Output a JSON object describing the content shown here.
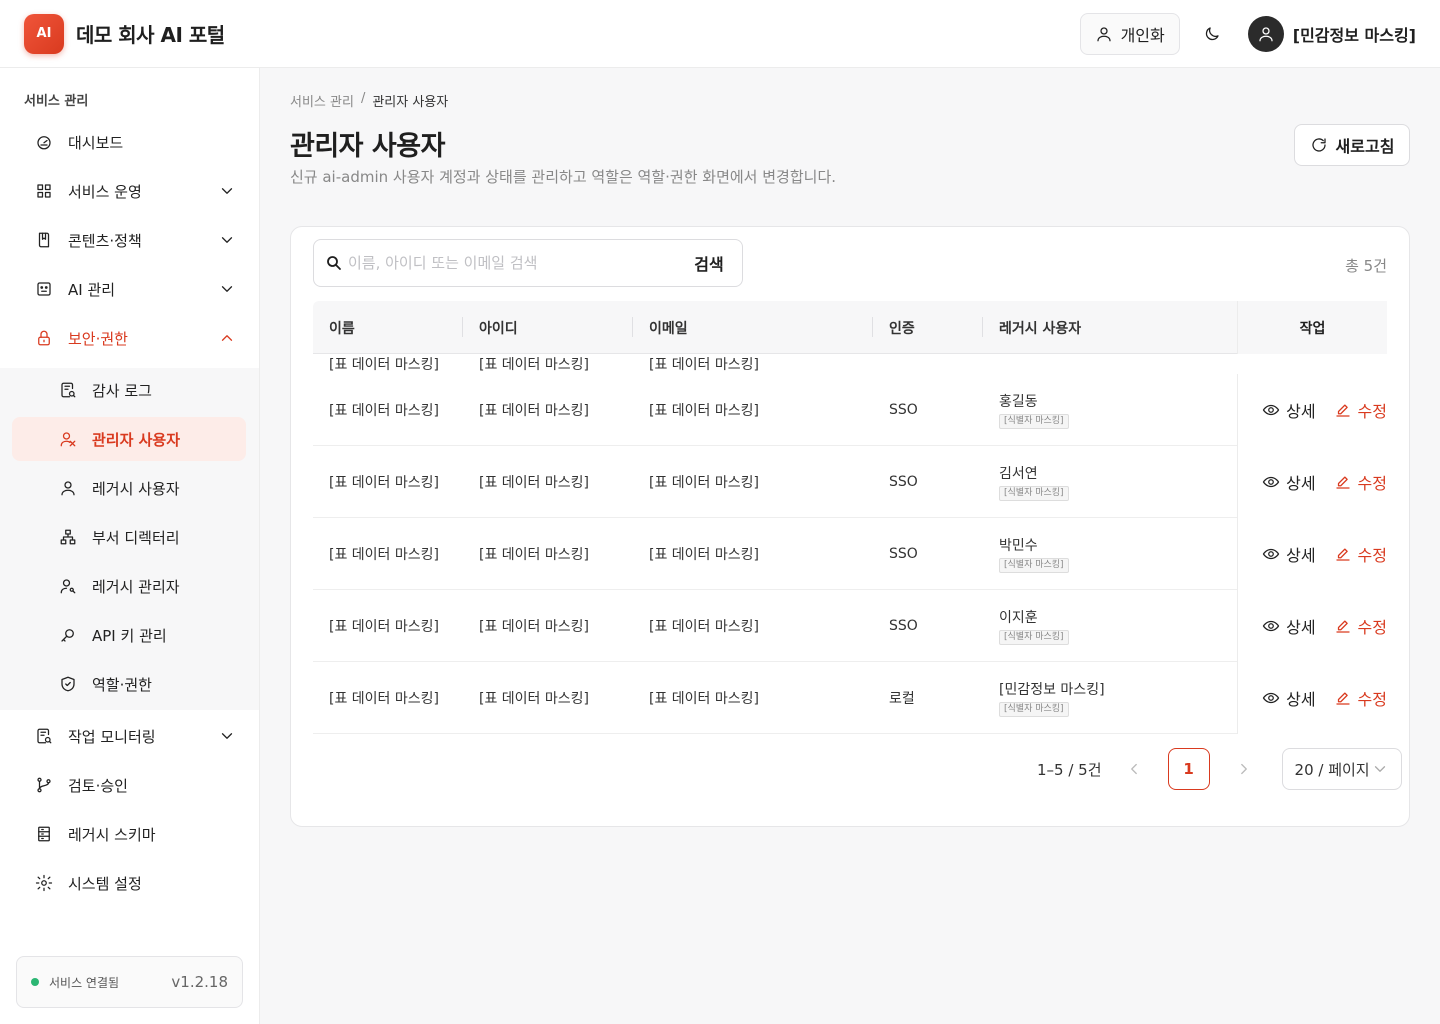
{
  "header": {
    "logo_text": "AI",
    "brand": "데모 회사 AI 포털",
    "personal_label": "개인화",
    "user_name": "[민감정보 마스킹]"
  },
  "sidebar": {
    "section_title": "서비스 관리",
    "items": [
      {
        "label": "대시보드",
        "icon": "dashboard-icon"
      },
      {
        "label": "서비스 운영",
        "icon": "grid-icon"
      },
      {
        "label": "콘텐츠·정책",
        "icon": "book-icon"
      },
      {
        "label": "AI 관리",
        "icon": "robot-icon"
      },
      {
        "label": "보안·권한",
        "icon": "lock-icon"
      },
      {
        "label": "감사 로그",
        "icon": "audit-icon"
      },
      {
        "label": "관리자 사용자",
        "icon": "users-icon"
      },
      {
        "label": "레거시 사용자",
        "icon": "user-icon"
      },
      {
        "label": "부서 디렉터리",
        "icon": "org-icon"
      },
      {
        "label": "레거시 관리자",
        "icon": "user-key-icon"
      },
      {
        "label": "API 키 관리",
        "icon": "key-icon"
      },
      {
        "label": "역할·권한",
        "icon": "shield-icon"
      },
      {
        "label": "작업 모니터링",
        "icon": "monitor-icon"
      },
      {
        "label": "검토·승인",
        "icon": "branch-icon"
      },
      {
        "label": "레거시 스키마",
        "icon": "schema-icon"
      },
      {
        "label": "시스템 설정",
        "icon": "gear-icon"
      }
    ],
    "status_text": "서비스 연결됨",
    "version": "v1.2.18",
    "status_color": "#2bb673"
  },
  "breadcrumb": {
    "parent": "서비스 관리",
    "separator": "/",
    "current": "관리자 사용자"
  },
  "page": {
    "title": "관리자 사용자",
    "description": "신규 ai-admin 사용자 계정과 상태를 관리하고 역할은 역할·권한 화면에서 변경합니다.",
    "refresh_label": "새로고침"
  },
  "search": {
    "placeholder": "이름, 아이디 또는 이메일 검색",
    "button": "검색"
  },
  "total": "총 5건",
  "table": {
    "headers": {
      "name": "이름",
      "id": "아이디",
      "email": "이메일",
      "auth": "인증",
      "legacy": "레거시 사용자",
      "action": "작업"
    },
    "partial_row": {
      "name": "[표 데이터 마스킹]",
      "id": "[표 데이터 마스킹]",
      "email": "[표 데이터 마스킹]"
    },
    "rows": [
      {
        "name": "[표 데이터 마스킹]",
        "id": "[표 데이터 마스킹]",
        "email": "[표 데이터 마스킹]",
        "auth": "SSO",
        "legacy": "홍길동",
        "tag": "[식별자 마스킹]"
      },
      {
        "name": "[표 데이터 마스킹]",
        "id": "[표 데이터 마스킹]",
        "email": "[표 데이터 마스킹]",
        "auth": "SSO",
        "legacy": "김서연",
        "tag": "[식별자 마스킹]"
      },
      {
        "name": "[표 데이터 마스킹]",
        "id": "[표 데이터 마스킹]",
        "email": "[표 데이터 마스킹]",
        "auth": "SSO",
        "legacy": "박민수",
        "tag": "[식별자 마스킹]"
      },
      {
        "name": "[표 데이터 마스킹]",
        "id": "[표 데이터 마스킹]",
        "email": "[표 데이터 마스킹]",
        "auth": "SSO",
        "legacy": "이지훈",
        "tag": "[식별자 마스킹]"
      },
      {
        "name": "[표 데이터 마스킹]",
        "id": "[표 데이터 마스킹]",
        "email": "[표 데이터 마스킹]",
        "auth": "로컬",
        "legacy": "[민감정보 마스킹]",
        "tag": "[식별자 마스킹]"
      }
    ],
    "detail_label": "상세",
    "edit_label": "수정"
  },
  "pagination": {
    "summary": "1–5 / 5건",
    "current_page": "1",
    "page_size": "20 / 페이지"
  },
  "colors": {
    "accent": "#d93a1f",
    "accent_bg": "#fdece8"
  }
}
